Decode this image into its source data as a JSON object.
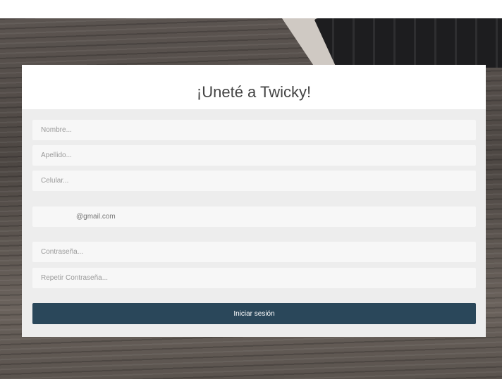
{
  "form": {
    "title": "¡Uneté a Twicky!",
    "fields": {
      "nombre": {
        "placeholder": "Nombre..."
      },
      "apellido": {
        "placeholder": "Apellido..."
      },
      "celular": {
        "placeholder": "Celular..."
      },
      "email_suffix": "@gmail.com",
      "contrasena": {
        "placeholder": "Contraseña..."
      },
      "repetir": {
        "placeholder": "Repetir Contraseña..."
      }
    },
    "submit_label": "Iniciar sesión"
  },
  "colors": {
    "button": "#2a475a",
    "card": "#ededed"
  }
}
